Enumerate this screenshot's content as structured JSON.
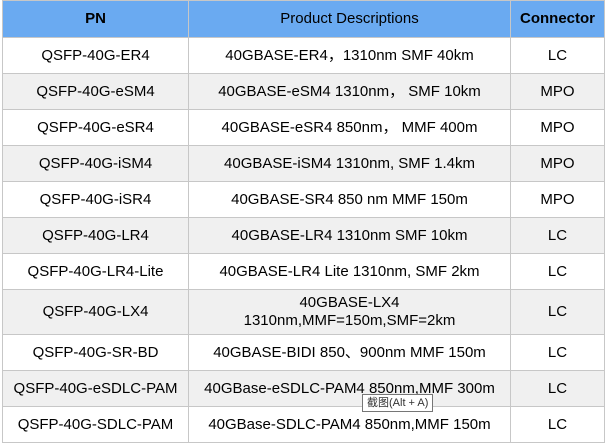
{
  "table": {
    "headers": [
      "PN",
      "Product Descriptions",
      "Connector"
    ],
    "rows": [
      {
        "pn": "QSFP-40G-ER4",
        "desc": "40GBASE-ER4，1310nm SMF 40km",
        "conn": "LC"
      },
      {
        "pn": "QSFP-40G-eSM4",
        "desc": "40GBASE-eSM4 1310nm， SMF 10km",
        "conn": "MPO"
      },
      {
        "pn": "QSFP-40G-eSR4",
        "desc": "40GBASE-eSR4 850nm， MMF 400m",
        "conn": "MPO"
      },
      {
        "pn": "QSFP-40G-iSM4",
        "desc": "40GBASE-iSM4 1310nm, SMF 1.4km",
        "conn": "MPO"
      },
      {
        "pn": "QSFP-40G-iSR4",
        "desc": "40GBASE-SR4 850 nm MMF 150m",
        "conn": "MPO"
      },
      {
        "pn": "QSFP-40G-LR4",
        "desc": "40GBASE-LR4 1310nm SMF 10km",
        "conn": "LC"
      },
      {
        "pn": "QSFP-40G-LR4-Lite",
        "desc": "40GBASE-LR4 Lite 1310nm, SMF 2km",
        "conn": "LC"
      },
      {
        "pn": "QSFP-40G-LX4",
        "desc_line1": "40GBASE-LX4",
        "desc_line2": "1310nm,MMF=150m,SMF=2km",
        "conn": "LC"
      },
      {
        "pn": "QSFP-40G-SR-BD",
        "desc": "40GBASE-BIDI 850、900nm MMF 150m",
        "conn": "LC"
      },
      {
        "pn": "QSFP-40G-eSDLC-PAM",
        "desc": "40GBase-eSDLC-PAM4 850nm,MMF 300m",
        "conn": "LC"
      },
      {
        "pn": "QSFP-40G-SDLC-PAM",
        "desc": "40GBase-SDLC-PAM4 850nm,MMF 150m",
        "conn": "LC"
      }
    ]
  },
  "tooltip": {
    "text": "截图(Alt + A)"
  },
  "colors": {
    "header_bg": "#6aaaf1",
    "alt_row_bg": "#f0f0f0",
    "border": "#c7c7c7"
  }
}
